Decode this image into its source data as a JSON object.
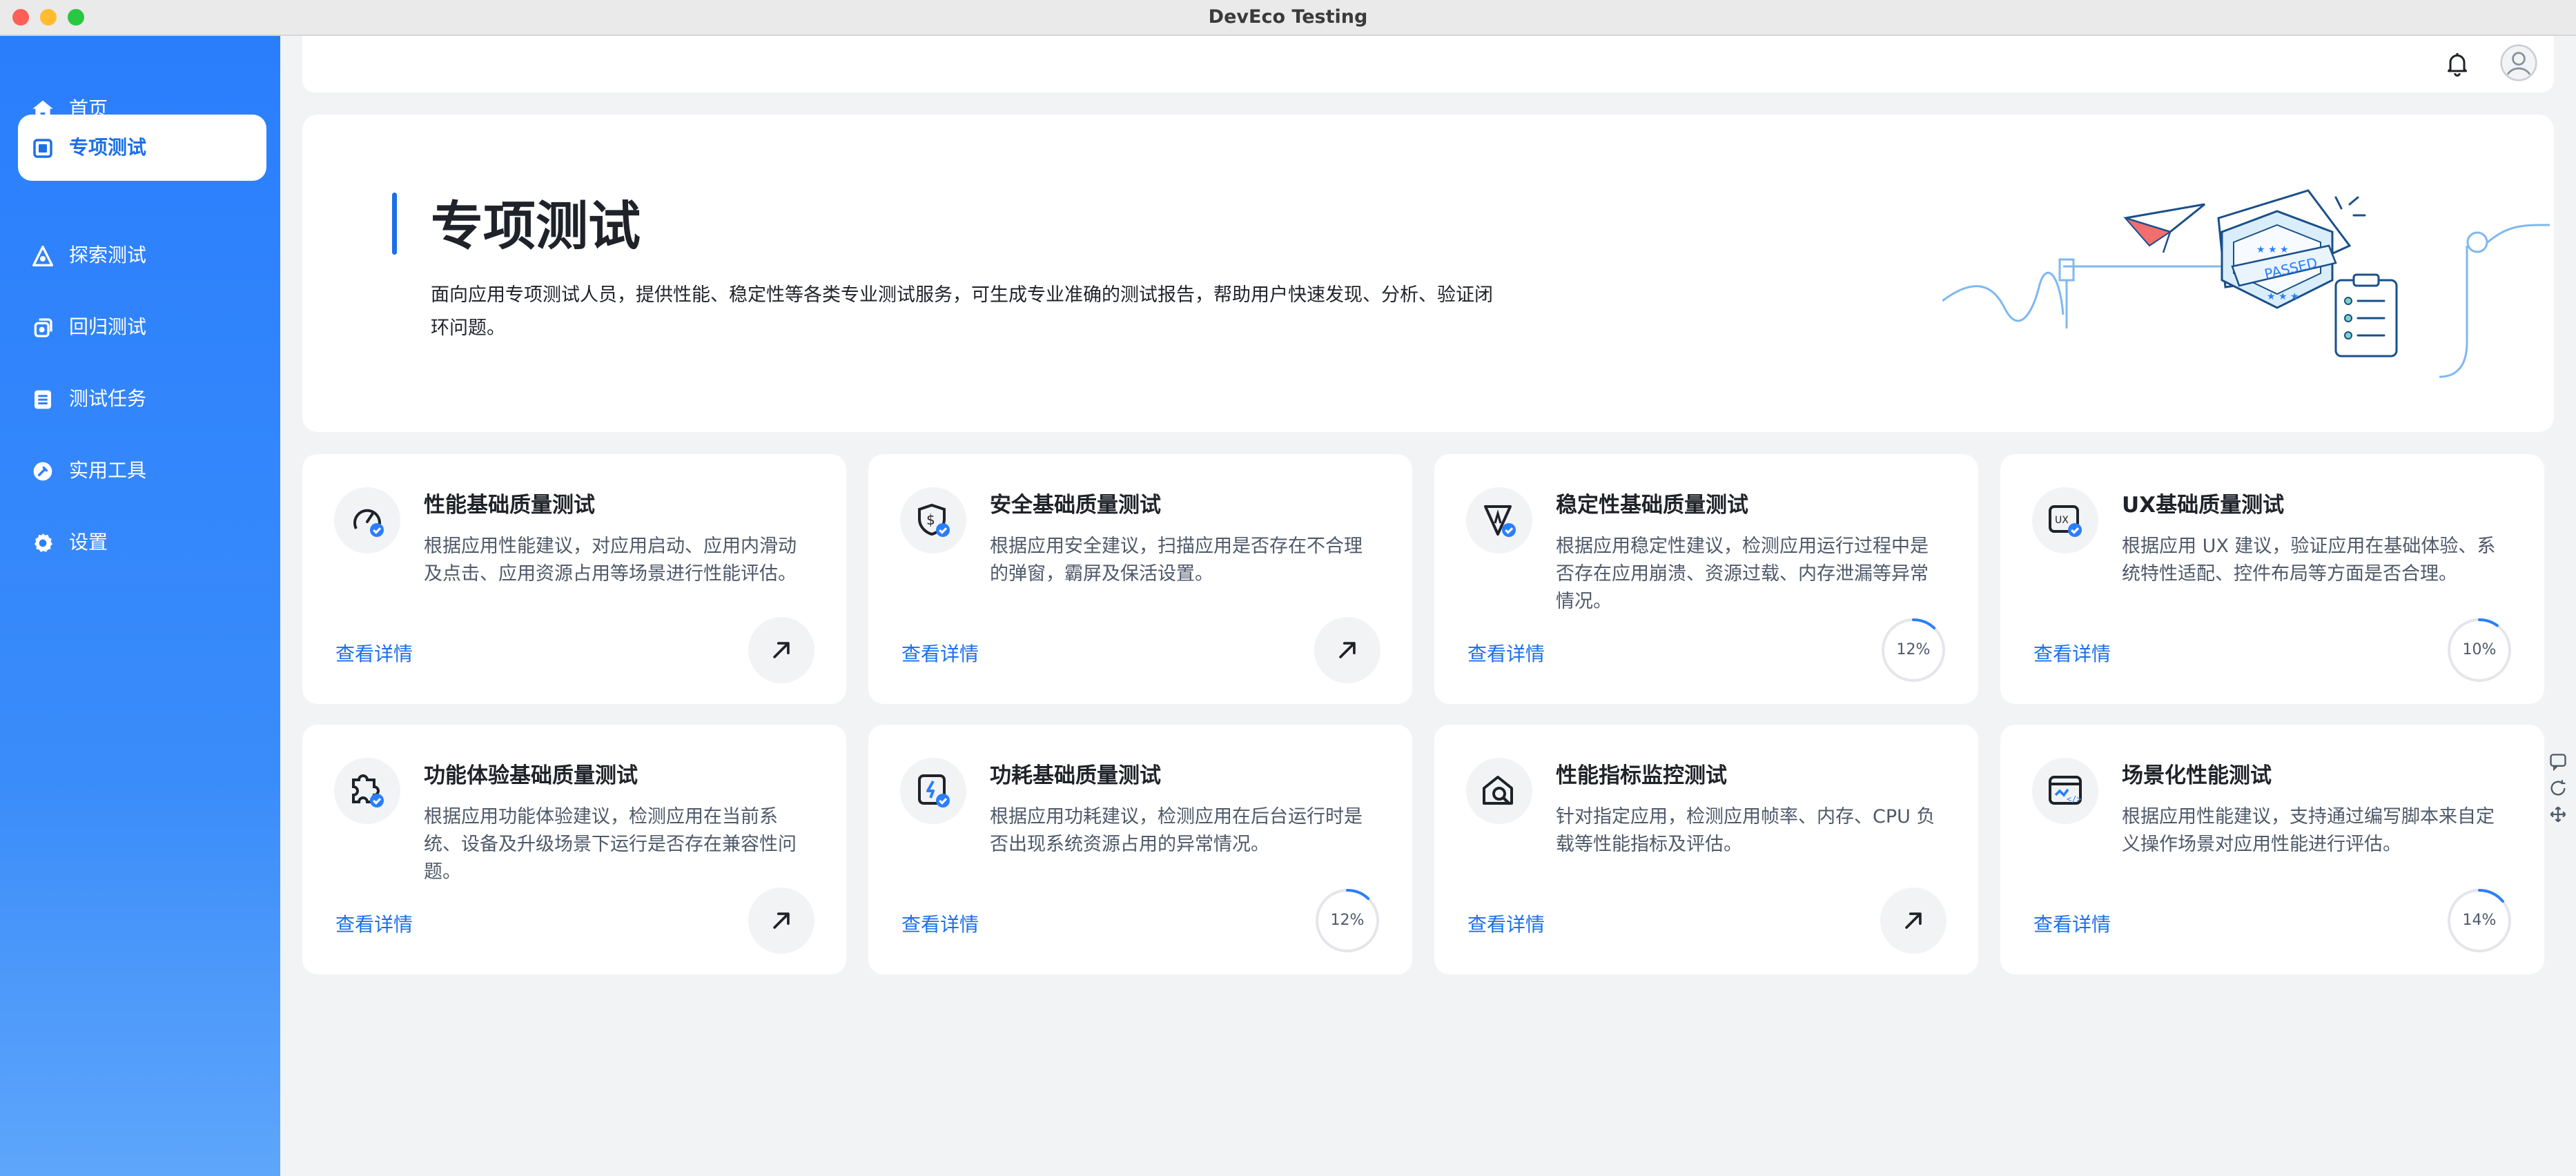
{
  "window": {
    "title": "DevEco Testing"
  },
  "sidebar": {
    "items": [
      {
        "label": "首页",
        "icon": "home-icon",
        "active": false
      },
      {
        "label": "专项测试",
        "icon": "special-test-icon",
        "active": true
      },
      {
        "label": "探索测试",
        "icon": "explore-icon",
        "active": false
      },
      {
        "label": "回归测试",
        "icon": "regression-icon",
        "active": false
      },
      {
        "label": "测试任务",
        "icon": "task-list-icon",
        "active": false
      },
      {
        "label": "实用工具",
        "icon": "tools-icon",
        "active": false
      },
      {
        "label": "设置",
        "icon": "gear-icon",
        "active": false
      }
    ]
  },
  "hero": {
    "title": "专项测试",
    "description": "面向应用专项测试人员，提供性能、稳定性等各类专业测试服务，可生成专业准确的测试报告，帮助用户快速发现、分析、验证闭环问题。",
    "illustration": {
      "badge_text": "PASSED"
    }
  },
  "cards": [
    {
      "title": "性能基础质量测试",
      "desc": "根据应用性能建议，对应用启动、应用内滑动及点击、应用资源占用等场景进行性能评估。",
      "link": "查看详情",
      "icon": "performance-gauge-icon",
      "progress": null
    },
    {
      "title": "安全基础质量测试",
      "desc": "根据应用安全建议，扫描应用是否存在不合理的弹窗，霸屏及保活设置。",
      "link": "查看详情",
      "icon": "security-shield-icon",
      "progress": null
    },
    {
      "title": "稳定性基础质量测试",
      "desc": "根据应用稳定性建议，检测应用运行过程中是否存在应用崩溃、资源过载、内存泄漏等异常情况。",
      "link": "查看详情",
      "icon": "stability-icon",
      "progress": "12%"
    },
    {
      "title": "UX基础质量测试",
      "desc": "根据应用 UX 建议，验证应用在基础体验、系统特性适配、控件布局等方面是否合理。",
      "link": "查看详情",
      "icon": "ux-icon",
      "progress": "10%"
    },
    {
      "title": "功能体验基础质量测试",
      "desc": "根据应用功能体验建议，检测应用在当前系统、设备及升级场景下运行是否存在兼容性问题。",
      "link": "查看详情",
      "icon": "function-experience-icon",
      "progress": null
    },
    {
      "title": "功耗基础质量测试",
      "desc": "根据应用功耗建议，检测应用在后台运行时是否出现系统资源占用的异常情况。",
      "link": "查看详情",
      "icon": "power-consumption-icon",
      "progress": "12%"
    },
    {
      "title": "性能指标监控测试",
      "desc": "针对指定应用，检测应用帧率、内存、CPU 负载等性能指标及评估。",
      "link": "查看详情",
      "icon": "performance-monitor-icon",
      "progress": null
    },
    {
      "title": "场景化性能测试",
      "desc": "根据应用性能建议，支持通过编写脚本来自定义操作场景对应用性能进行评估。",
      "link": "查看详情",
      "icon": "scenario-script-icon",
      "progress": "14%"
    }
  ],
  "colors": {
    "accent": "#1c6fe8",
    "sidebar": "#2a7efc",
    "background": "#f1f3f5"
  }
}
